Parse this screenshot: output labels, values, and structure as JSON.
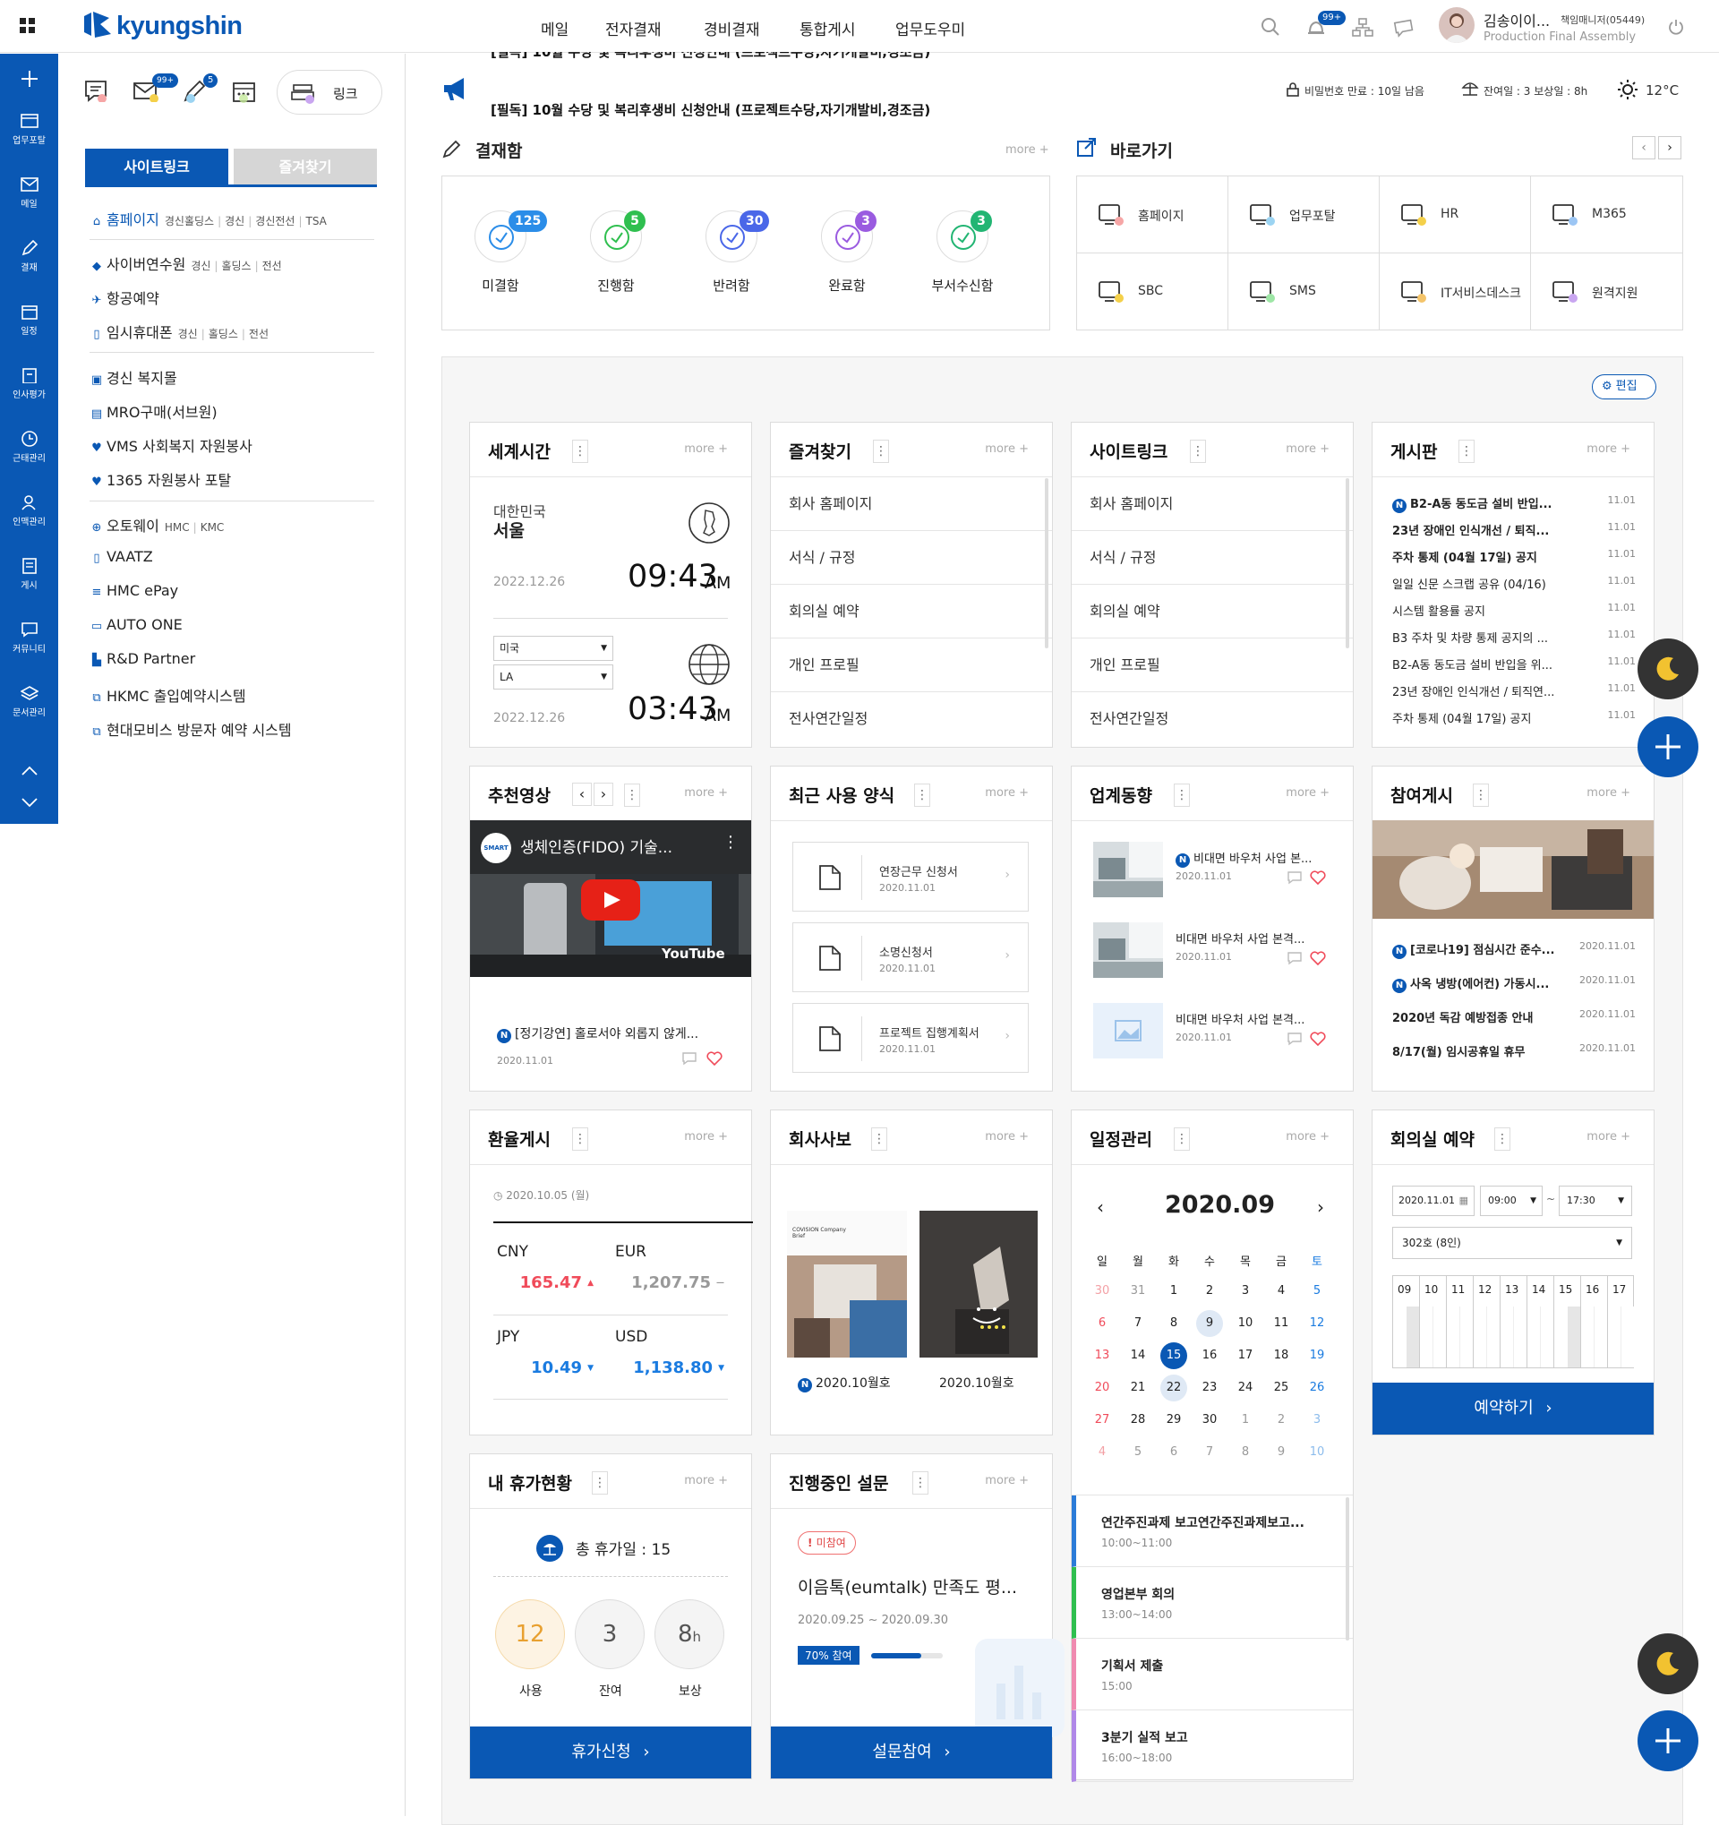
{
  "header": {
    "logo_text": "kyungshin",
    "nav": [
      "메일",
      "전자결재",
      "경비결재",
      "통합게시",
      "업무도우미"
    ],
    "notif_badge": "99+",
    "user_name": "김송이이...",
    "user_role": "책임매니저(05449)",
    "user_dept": "Production Final Assembly"
  },
  "rail": {
    "items": [
      "업무포탈",
      "메일",
      "결재",
      "일정",
      "인사평가",
      "근태관리",
      "인맥관리",
      "게시",
      "커뮤니티",
      "문서관리"
    ]
  },
  "side": {
    "quick_badges": {
      "mail": "99+",
      "approval": "5"
    },
    "link_label": "링크",
    "tab_active": "사이트링크",
    "tab_inactive": "즐겨찾기",
    "links": [
      {
        "label": "홈페이지",
        "subs": [
          "경신홀딩스",
          "경신",
          "경신전선",
          "TSA"
        ]
      },
      {
        "label": "사이버연수원",
        "subs": [
          "경신",
          "홀딩스",
          "전선"
        ]
      },
      {
        "label": "항공예약",
        "subs": []
      },
      {
        "label": "임시휴대폰",
        "subs": [
          "경신",
          "홀딩스",
          "전선"
        ]
      },
      {
        "label": "경신 복지몰",
        "subs": []
      },
      {
        "label": "MRO구매(서브원)",
        "subs": []
      },
      {
        "label": "VMS 사회복지 자원봉사",
        "subs": []
      },
      {
        "label": "1365 자원봉사 포탈",
        "subs": []
      },
      {
        "label": "오토웨이",
        "subs": [
          "HMC",
          "KMC"
        ]
      },
      {
        "label": "VAATZ",
        "subs": []
      },
      {
        "label": "HMC ePay",
        "subs": []
      },
      {
        "label": "AUTO ONE",
        "subs": []
      },
      {
        "label": "R&D Partner",
        "subs": []
      },
      {
        "label": "HKMC 출입예약시스템",
        "subs": []
      },
      {
        "label": "현대모비스 방문자 예약 시스템",
        "subs": []
      }
    ]
  },
  "notice": {
    "text": "[필독] 10월 수당 및 복리후생비 신청안내 (프로젝트수당,자기개발비,경조금)",
    "password": "비밀번호 만료 : 10일 남음",
    "leave": "잔여일 : 3  보상일 : 8h",
    "weather": "12°C"
  },
  "approval": {
    "title": "결재함",
    "more": "more +",
    "items": [
      {
        "label": "미결함",
        "count": "125",
        "color": "#2b8de8"
      },
      {
        "label": "진행함",
        "count": "5",
        "color": "#2fbf4f"
      },
      {
        "label": "반려함",
        "count": "30",
        "color": "#4a67e8"
      },
      {
        "label": "완료함",
        "count": "3",
        "color": "#9a5be0"
      },
      {
        "label": "부서수신함",
        "count": "3",
        "color": "#22b573"
      }
    ]
  },
  "shortcuts": {
    "title": "바로가기",
    "items": [
      "홈페이지",
      "업무포탈",
      "HR",
      "M365",
      "SBC",
      "SMS",
      "IT서비스데스크",
      "원격지원"
    ]
  },
  "edit_label": "편집",
  "world_time": {
    "title": "세계시간",
    "more": "more +",
    "country1": "대한민국",
    "city1": "서울",
    "date1": "2022.12.26",
    "time1": "09:43",
    "ampm1": "AM",
    "country2": "미국",
    "city2": "LA",
    "date2": "2022.12.26",
    "time2": "03:43",
    "ampm2": "AM"
  },
  "favorites": {
    "title": "즐겨찾기",
    "more": "more +",
    "items": [
      "회사 홈페이지",
      "서식 / 규정",
      "회의실 예약",
      "개인 프로필",
      "전사연간일정"
    ]
  },
  "site_links": {
    "title": "사이트링크",
    "more": "more +",
    "items": [
      "회사 홈페이지",
      "서식 / 규정",
      "회의실 예약",
      "개인 프로필",
      "전사연간일정"
    ]
  },
  "board": {
    "title": "게시판",
    "more": "more +",
    "items": [
      {
        "title": "B2-A동 동도금 설비 반입...",
        "date": "11.01",
        "new": true,
        "bold": true
      },
      {
        "title": "23년 장애인 인식개선 / 퇴직...",
        "date": "11.01",
        "new": false,
        "bold": true
      },
      {
        "title": "주차 통제 (04월 17일) 공지",
        "date": "11.01",
        "new": false,
        "bold": true
      },
      {
        "title": "일일 신문 스크랩 공유 (04/16)",
        "date": "11.01",
        "new": false,
        "bold": false
      },
      {
        "title": "시스템 활용률 공지",
        "date": "11.01",
        "new": false,
        "bold": false
      },
      {
        "title": "B3 주차 및 차량 통제 공지의 ...",
        "date": "11.01",
        "new": false,
        "bold": false
      },
      {
        "title": "B2-A동 동도금 설비 반입을 위...",
        "date": "11.01",
        "new": false,
        "bold": false
      },
      {
        "title": "23년 장애인 인식개선 / 퇴직연...",
        "date": "11.01",
        "new": false,
        "bold": false
      },
      {
        "title": "주차 통제 (04월 17일) 공지",
        "date": "11.01",
        "new": false,
        "bold": false
      }
    ]
  },
  "video": {
    "title": "추천영상",
    "more": "more +",
    "video_title": "생체인증(FIDO) 기술...",
    "channel": "SMART",
    "yt": "YouTube",
    "caption": "[정기강연] 홀로서야 외롭지 않게...",
    "date": "2020.11.01"
  },
  "recent_forms": {
    "title": "최근 사용 양식",
    "more": "more +",
    "items": [
      {
        "name": "연장근무 신청서",
        "date": "2020.11.01"
      },
      {
        "name": "소명신청서",
        "date": "2020.11.01"
      },
      {
        "name": "프로젝트 집행계획서",
        "date": "2020.11.01"
      }
    ]
  },
  "industry": {
    "title": "업계동향",
    "more": "more +",
    "items": [
      {
        "title": "비대면 바우처 사업 본...",
        "date": "2020.11.01",
        "new": true
      },
      {
        "title": "비대면 바우처 사업 본격...",
        "date": "2020.11.01",
        "new": false
      },
      {
        "title": "비대면 바우처 사업 본격...",
        "date": "2020.11.01",
        "new": false
      }
    ]
  },
  "participation": {
    "title": "참여게시",
    "more": "more +",
    "items": [
      {
        "title": "[코로나19] 점심시간 준수...",
        "date": "2020.11.01",
        "new": true
      },
      {
        "title": "사옥 냉방(에어컨) 가동시...",
        "date": "2020.11.01",
        "new": true
      },
      {
        "title": "2020년 독감 예방접종 안내",
        "date": "2020.11.01",
        "new": false
      },
      {
        "title": "8/17(월) 임시공휴일 휴무",
        "date": "2020.11.01",
        "new": false
      }
    ]
  },
  "exchange": {
    "title": "환율게시",
    "more": "more +",
    "date": "2020.10.05 (월)",
    "rates": [
      {
        "cur": "CNY",
        "val": "165.47",
        "dir": "up"
      },
      {
        "cur": "EUR",
        "val": "1,207.75",
        "dir": "flat"
      },
      {
        "cur": "JPY",
        "val": "10.49",
        "dir": "down"
      },
      {
        "cur": "USD",
        "val": "1,138.80",
        "dir": "down"
      }
    ]
  },
  "newsletter": {
    "title": "회사사보",
    "more": "more +",
    "items": [
      "2020.10월호",
      "2020.10월호"
    ],
    "cover_title": "COVISION Company Brief"
  },
  "schedule": {
    "title": "일정관리",
    "more": "more +",
    "month": "2020.09",
    "weekdays": [
      "일",
      "월",
      "화",
      "수",
      "목",
      "금",
      "토"
    ],
    "weeks": [
      [
        "30",
        "31",
        "1",
        "2",
        "3",
        "4",
        "5"
      ],
      [
        "6",
        "7",
        "8",
        "9",
        "10",
        "11",
        "12"
      ],
      [
        "13",
        "14",
        "15",
        "16",
        "17",
        "18",
        "19"
      ],
      [
        "20",
        "21",
        "22",
        "23",
        "24",
        "25",
        "26"
      ],
      [
        "27",
        "28",
        "29",
        "30",
        "1",
        "2",
        "3"
      ],
      [
        "4",
        "5",
        "6",
        "7",
        "8",
        "9",
        "10"
      ]
    ],
    "events": [
      {
        "title": "연간주진과제 보고연간주진과제보고...",
        "time": "10:00~11:00",
        "color": "#2b7bd8"
      },
      {
        "title": "영업본부 회의",
        "time": "13:00~14:00",
        "color": "#2fbf4f"
      },
      {
        "title": "기획서 제출",
        "time": "15:00",
        "color": "#f08ab0"
      },
      {
        "title": "3분기 실적 보고",
        "time": "16:00~18:00",
        "color": "#b088e8"
      }
    ]
  },
  "meeting": {
    "title": "회의실 예약",
    "more": "more +",
    "date": "2020.11.01",
    "start": "09:00",
    "end": "17:30",
    "room": "302호 (8인)",
    "hours": [
      "09",
      "10",
      "11",
      "12",
      "13",
      "14",
      "15",
      "16",
      "17"
    ],
    "button": "예약하기"
  },
  "vacation": {
    "title": "내 휴가현황",
    "more": "more +",
    "total": "총 휴가일 : 15",
    "used": "12",
    "remain": "3",
    "comp": "8",
    "comp_unit": "h",
    "labels": [
      "사용",
      "잔여",
      "보상"
    ],
    "button": "휴가신청"
  },
  "survey": {
    "title": "진행중인 설문",
    "more": "more +",
    "status": "미참여",
    "name": "이음톡(eumtalk) 만족도 평...",
    "period": "2020.09.25 ~ 2020.09.30",
    "rate": "70% 참여",
    "progress": 0.7,
    "button": "설문참여"
  }
}
